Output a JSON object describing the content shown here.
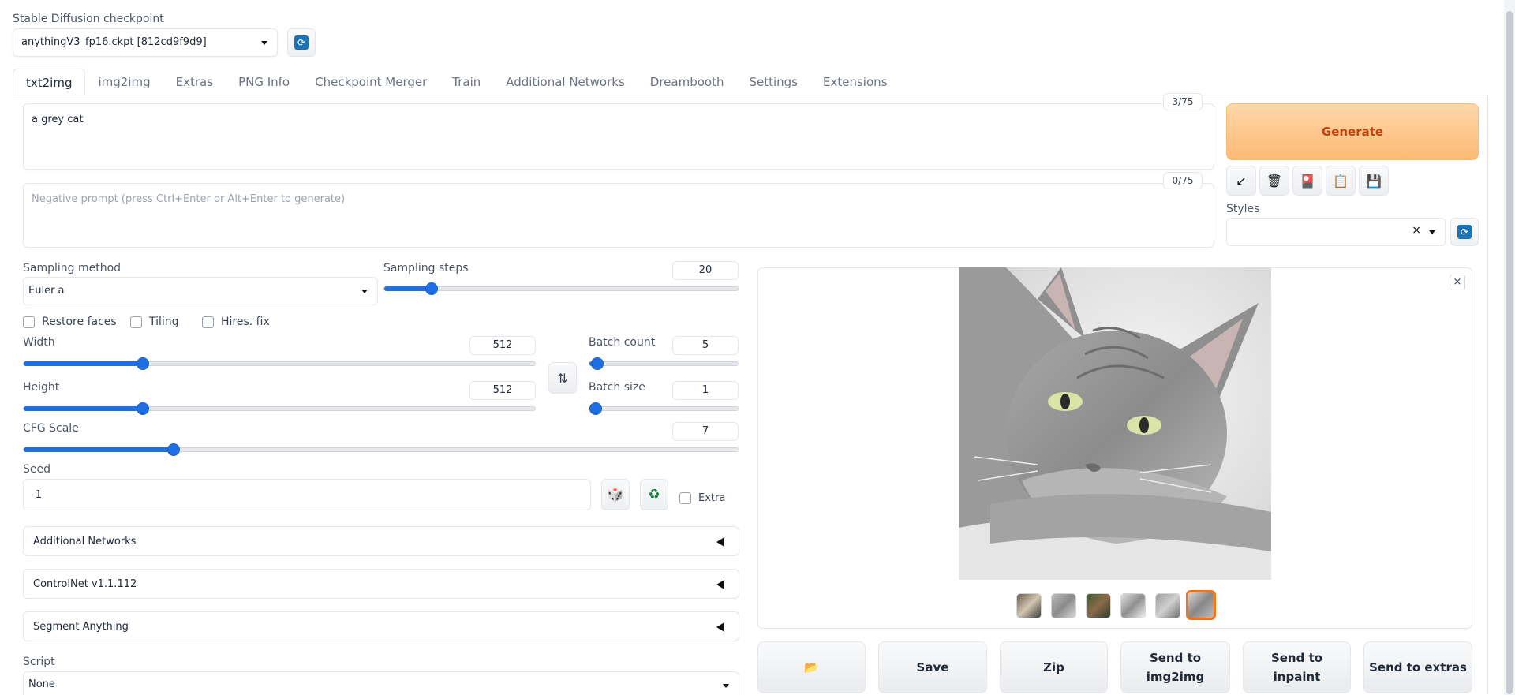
{
  "checkpoint": {
    "label": "Stable Diffusion checkpoint",
    "value": "anythingV3_fp16.ckpt [812cd9f9d9]"
  },
  "tabs": [
    "txt2img",
    "img2img",
    "Extras",
    "PNG Info",
    "Checkpoint Merger",
    "Train",
    "Additional Networks",
    "Dreambooth",
    "Settings",
    "Extensions"
  ],
  "prompt": {
    "value": "a grey cat",
    "token_count": "3/75"
  },
  "negative_prompt": {
    "placeholder": "Negative prompt (press Ctrl+Enter or Alt+Enter to generate)",
    "token_count": "0/75"
  },
  "generate": {
    "label": "Generate"
  },
  "styles": {
    "label": "Styles",
    "clear": "×"
  },
  "tool_icons": {
    "read": "↙",
    "trash": "🗑",
    "extra_networks": "🎴",
    "paste": "📋",
    "save_style": "💾"
  },
  "sampling": {
    "method_label": "Sampling method",
    "method_value": "Euler a",
    "steps_label": "Sampling steps",
    "steps_value": "20"
  },
  "checkboxes": {
    "restore_faces": "Restore faces",
    "tiling": "Tiling",
    "hires_fix": "Hires. fix"
  },
  "width": {
    "label": "Width",
    "value": "512",
    "fraction": 0.232
  },
  "height": {
    "label": "Height",
    "value": "512",
    "fraction": 0.232
  },
  "batch_count": {
    "label": "Batch count",
    "value": "5",
    "fraction": 0.05
  },
  "batch_size": {
    "label": "Batch size",
    "value": "1",
    "fraction": 0.0
  },
  "cfg_scale": {
    "label": "CFG Scale",
    "value": "7",
    "fraction": 0.21
  },
  "steps_fraction": 0.133,
  "swap_icon": "⇅",
  "seed": {
    "label": "Seed",
    "value": "-1",
    "random_icon": "🎲",
    "reuse_icon": "♻",
    "extra_label": "Extra"
  },
  "accordions": [
    "Additional Networks",
    "ControlNet v1.1.112",
    "Segment Anything"
  ],
  "script": {
    "label": "Script",
    "value": "None"
  },
  "gallery": {
    "close": "×"
  },
  "actions": {
    "folder_icon": "📂",
    "save": "Save",
    "zip": "Zip",
    "send_img2img": "Send to\nimg2img",
    "send_inpaint": "Send to\ninpaint",
    "send_extras": "Send to extras"
  }
}
